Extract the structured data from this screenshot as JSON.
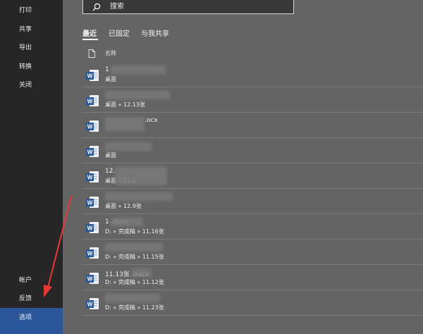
{
  "sidebar": {
    "top_items": [
      {
        "label": "打印"
      },
      {
        "label": "共享"
      },
      {
        "label": "导出"
      },
      {
        "label": "转换"
      },
      {
        "label": "关闭"
      }
    ],
    "bottom_items": [
      {
        "label": "帐户"
      },
      {
        "label": "反馈"
      },
      {
        "label": "选项",
        "selected": true
      }
    ]
  },
  "search": {
    "placeholder": "搜索",
    "icon": "search-icon"
  },
  "tabs": [
    {
      "label": "最近",
      "active": true
    },
    {
      "label": "已固定",
      "active": false
    },
    {
      "label": "与我共享",
      "active": false
    }
  ],
  "list_header": {
    "icon": "file-icon",
    "name_label": "名称"
  },
  "files": [
    {
      "name": "1",
      "path": "桌面"
    },
    {
      "name": "",
      "path": "桌面 » 12.13张"
    },
    {
      "name": ".ocx",
      "path": ""
    },
    {
      "name": "",
      "path": "桌面"
    },
    {
      "name": "12.",
      "path": "桌面 » 12.1"
    },
    {
      "name": "",
      "path": "桌面 » 12.9张"
    },
    {
      "name": "1 .docx",
      "path": "D: » 完成稿 » 11.16张"
    },
    {
      "name": "",
      "path": "D: » 完成稿 » 11.15张"
    },
    {
      "name": "11.13张 .docx",
      "path": "D: » 完成稿 » 11.12张"
    },
    {
      "name": "",
      "path": "D: » 完成稿 » 11.23张"
    }
  ],
  "colors": {
    "sidebar_bg": "#262626",
    "content_bg": "#646464",
    "selected_bg": "#2b579a",
    "annotation_arrow": "#e53935",
    "word_blue": "#2b579a"
  }
}
